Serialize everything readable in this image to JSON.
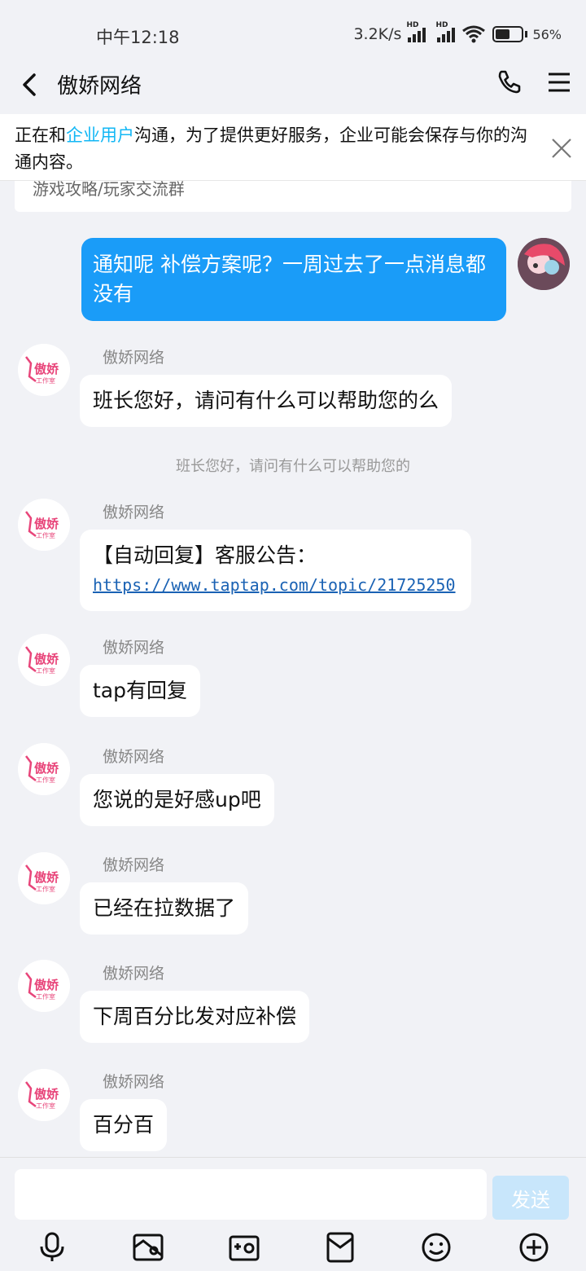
{
  "status_bar": {
    "time": "中午12:18",
    "net_speed": "3.2K/s",
    "signal_badge_1": "HD",
    "signal_badge_2": "HD",
    "battery_percent": "56",
    "battery_level": 0.56,
    "icons": [
      "signal-hd-icon",
      "signal-hd-icon",
      "wifi-icon",
      "battery-icon"
    ]
  },
  "header": {
    "title": "傲娇网络",
    "icons": [
      "back-arrow-icon",
      "phone-icon",
      "menu-icon"
    ]
  },
  "notice": {
    "text_before": "正在和",
    "highlight": "企业用户",
    "text_after": "沟通，为了提供更好服务，企业可能会保存与你的沟通内容。",
    "highlight_color": "#12b7f5"
  },
  "hint_card": {
    "text": "游戏攻略/玩家交流群"
  },
  "messages": [
    {
      "from": "me",
      "text": "通知呢 补偿方案呢？一周过去了一点消息都没有"
    },
    {
      "from": "other",
      "sender": "傲娇网络",
      "text": "班长您好，请问有什么可以帮助您的么"
    },
    {
      "type": "system",
      "text": "班长您好，请问有什么可以帮助您的"
    },
    {
      "from": "other",
      "sender": "傲娇网络",
      "text": "【自动回复】客服公告：",
      "link": "https://www.taptap.com/topic/21725250"
    },
    {
      "from": "other",
      "sender": "傲娇网络",
      "text": "tap有回复"
    },
    {
      "from": "other",
      "sender": "傲娇网络",
      "text": "您说的是好感up吧"
    },
    {
      "from": "other",
      "sender": "傲娇网络",
      "text": "已经在拉数据了"
    },
    {
      "from": "other",
      "sender": "傲娇网络",
      "text": "下周百分比发对应补偿"
    },
    {
      "from": "other",
      "sender": "傲娇网络",
      "text": "百分百"
    }
  ],
  "avatar": {
    "logo_text": "傲娇",
    "logo_sub": "工作室",
    "brand_color": "#e8457a"
  },
  "input": {
    "placeholder": "",
    "value": "",
    "send_label": "发送"
  },
  "toolbar": {
    "icons": [
      "microphone-icon",
      "image-icon",
      "camera-icon",
      "red-packet-icon",
      "emoji-icon",
      "plus-icon"
    ]
  },
  "colors": {
    "accent": "#1a9cf8",
    "background": "#f1f2f6",
    "link": "#1a62b4"
  }
}
